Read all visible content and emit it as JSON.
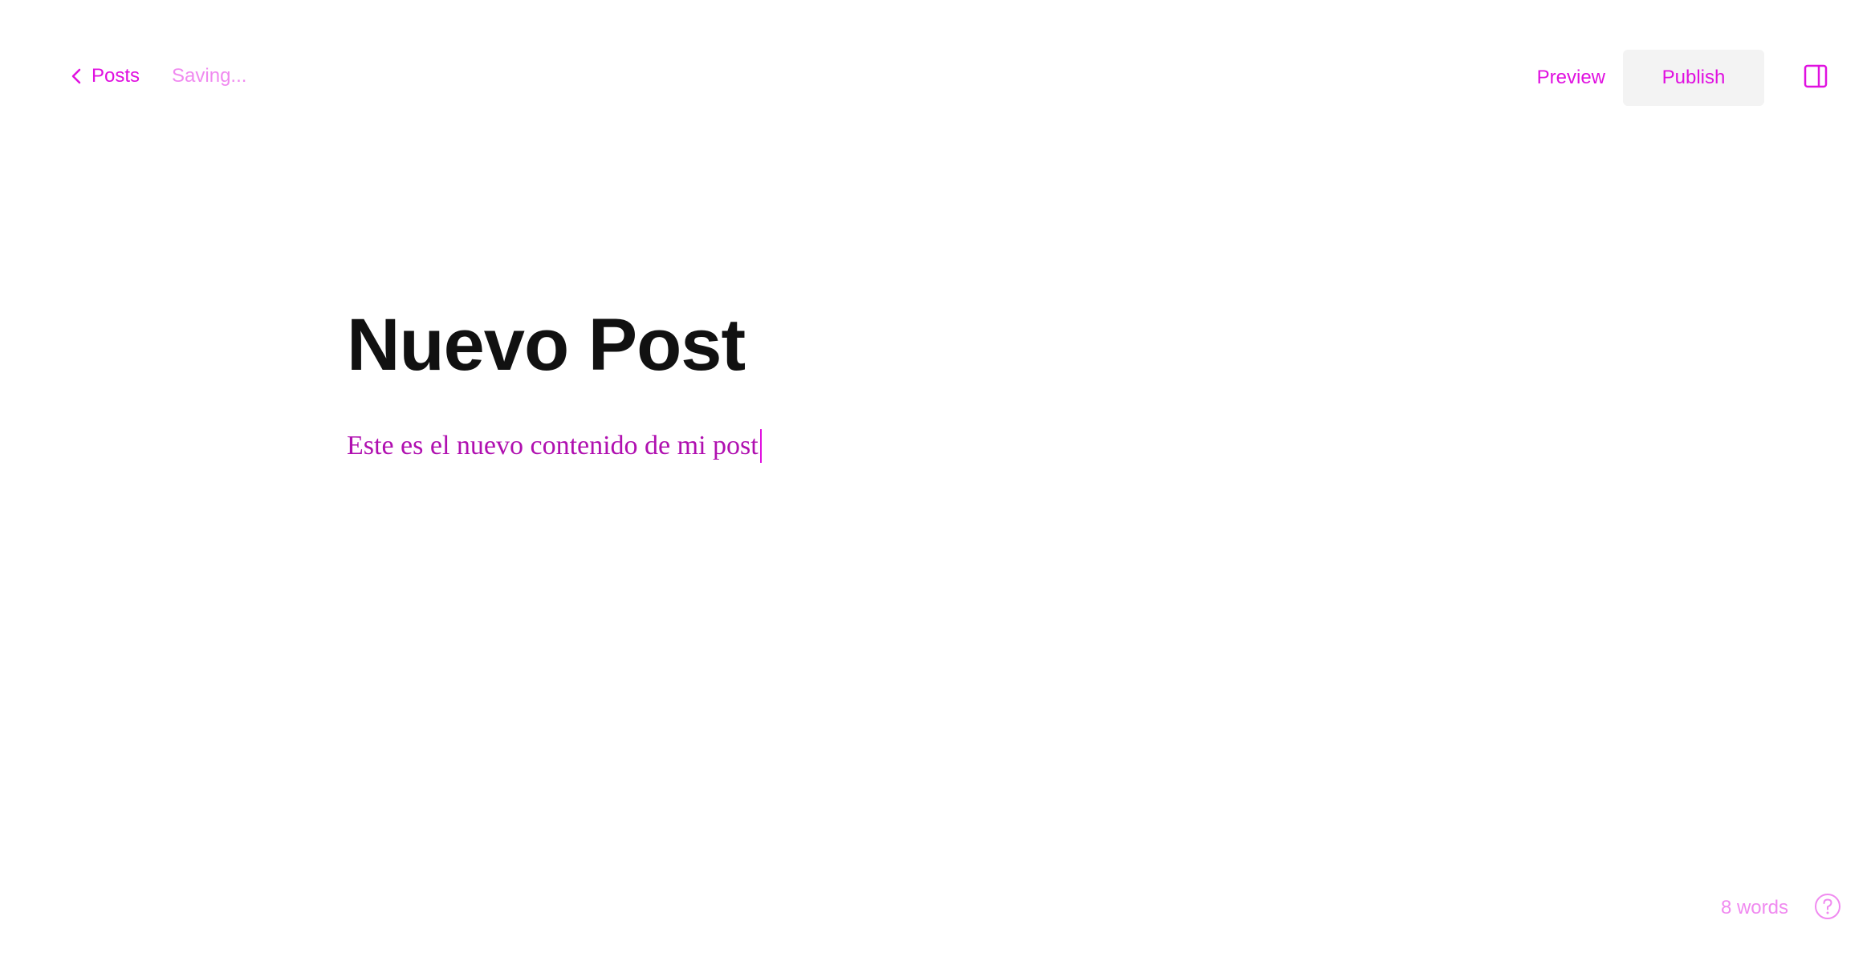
{
  "header": {
    "back_label": "Posts",
    "status_text": "Saving...",
    "preview_label": "Preview",
    "publish_label": "Publish"
  },
  "editor": {
    "title": "Nuevo Post",
    "body": "Este es el nuevo contenido de mi post"
  },
  "footer": {
    "word_count": "8 words"
  },
  "icons": {
    "back": "chevron-left-icon",
    "sidebar": "sidebar-toggle-icon",
    "help": "question-circle-icon"
  },
  "colors": {
    "accent": "#e010e0",
    "muted": "#f08af0",
    "title": "#111111",
    "publish_bg": "#f3f3f3"
  }
}
